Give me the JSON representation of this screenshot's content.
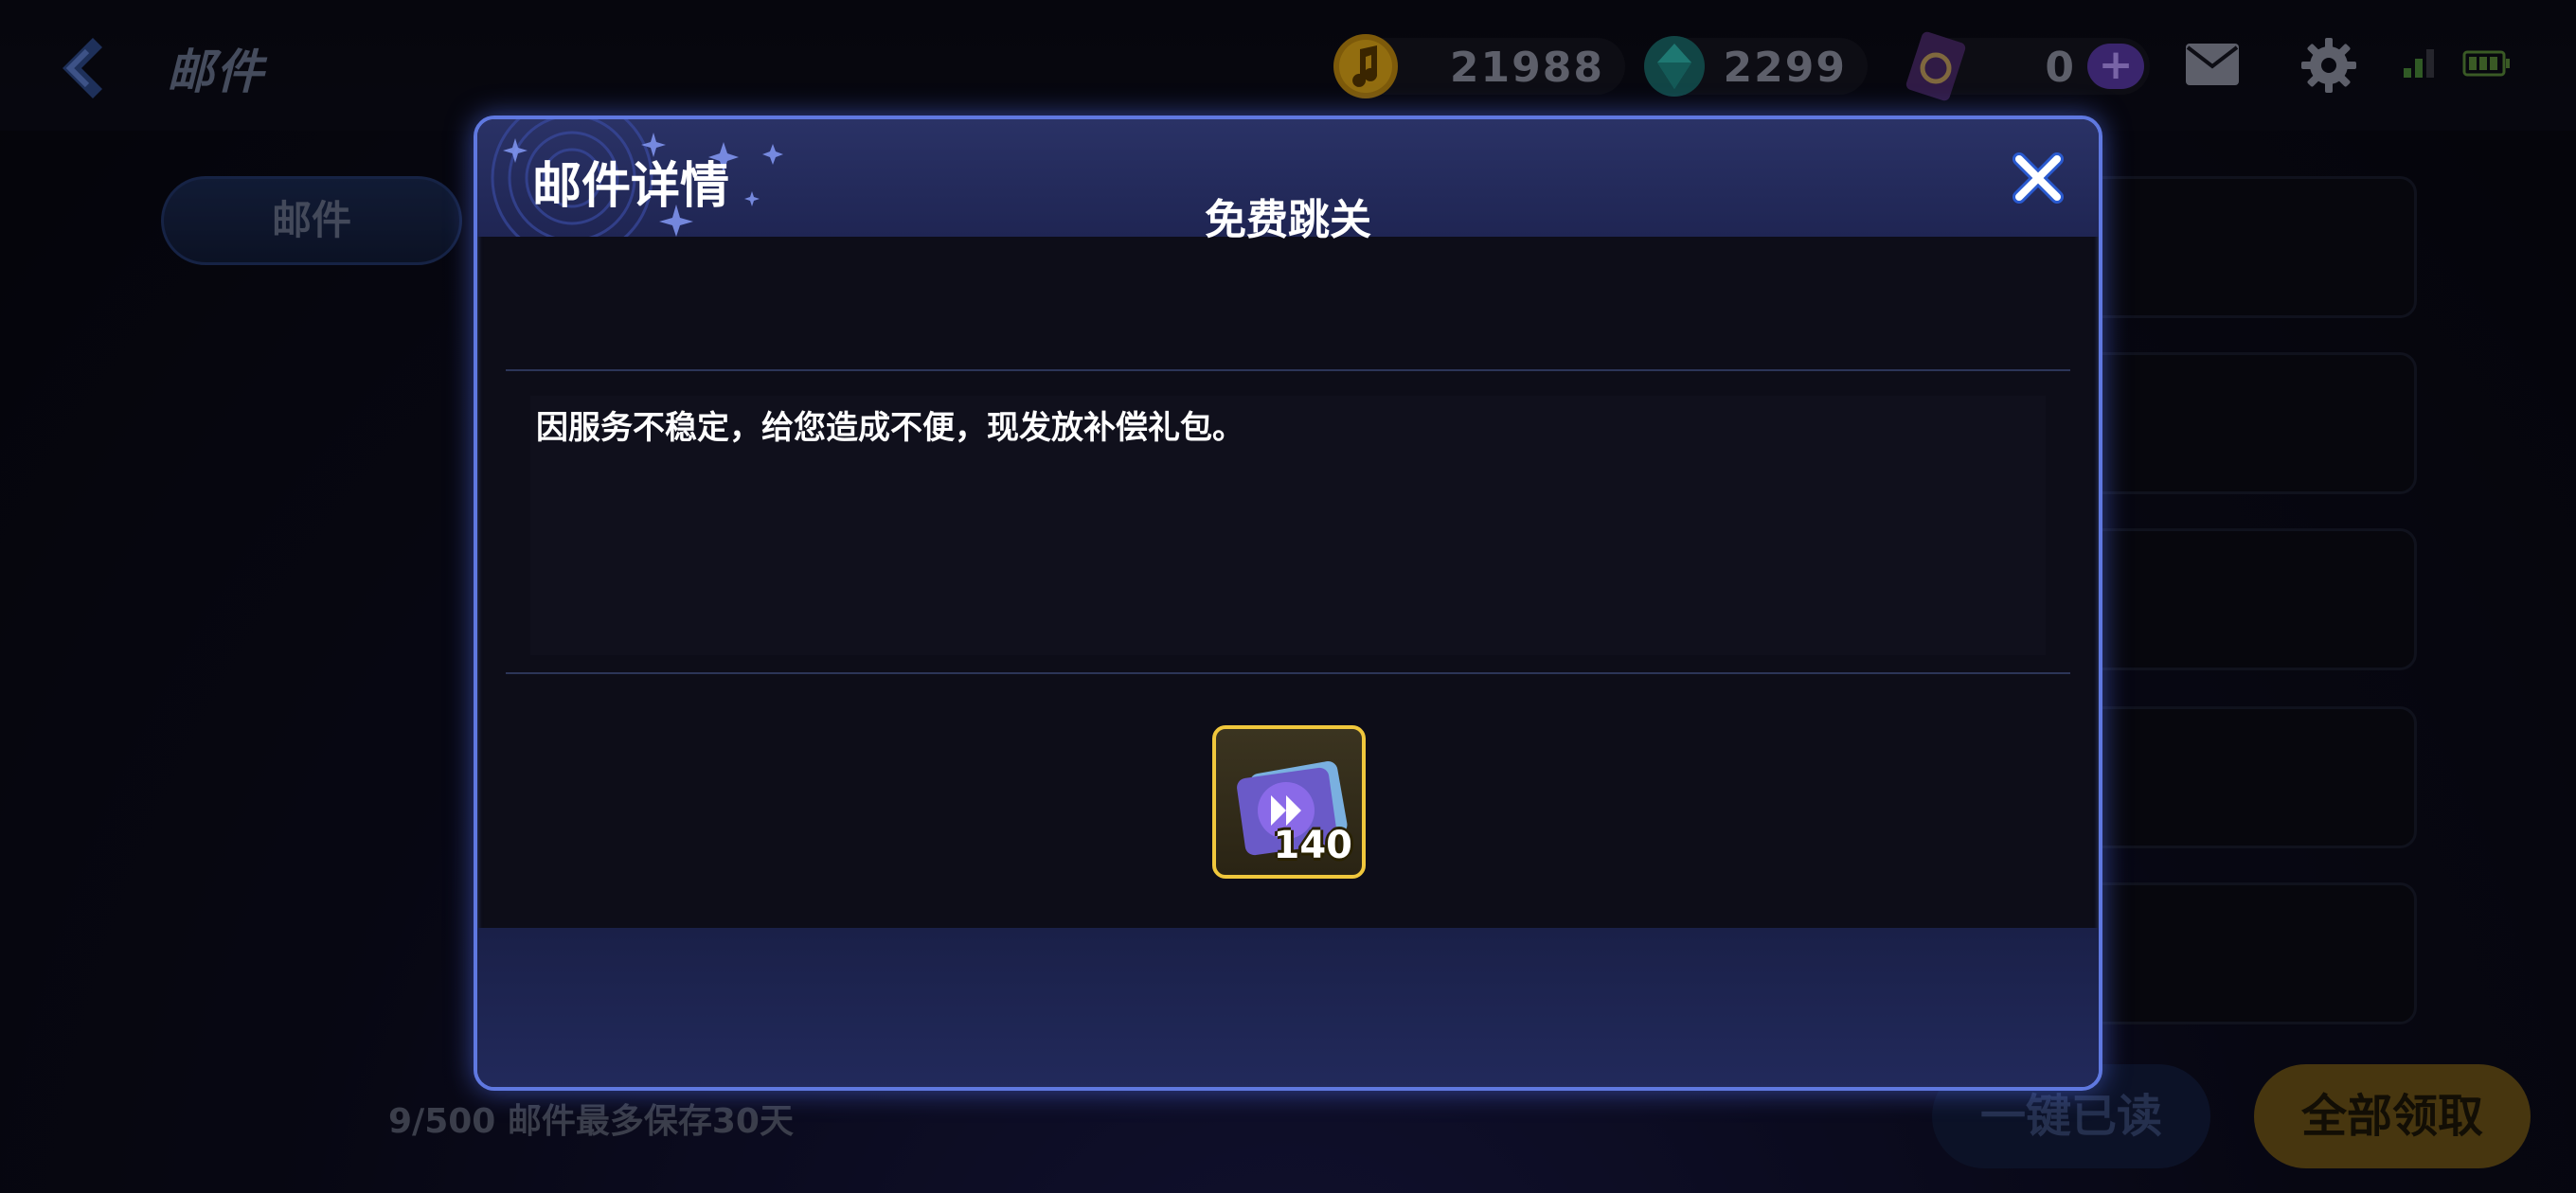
{
  "header": {
    "title": "邮件",
    "currencies": {
      "gold": "21988",
      "gems": "2299",
      "tickets": "0",
      "plus": "+"
    }
  },
  "sidebar": {
    "tab_label": "邮件"
  },
  "footer": {
    "count_text": "9/500 邮件最多保存30天",
    "read_all_label": "一键已读",
    "claim_all_label": "全部领取"
  },
  "modal": {
    "title": "邮件详情",
    "subject": "免费跳关",
    "content": "因服务不稳定，给您造成不便，现发放补偿礼包。",
    "reward": {
      "icon": "skip-ticket-icon",
      "count": "140"
    }
  },
  "colors": {
    "accent_border": "#5f78e0",
    "reward_border": "#f0c73c",
    "claim_button": "#6d5418",
    "read_button": "#131c3c"
  }
}
